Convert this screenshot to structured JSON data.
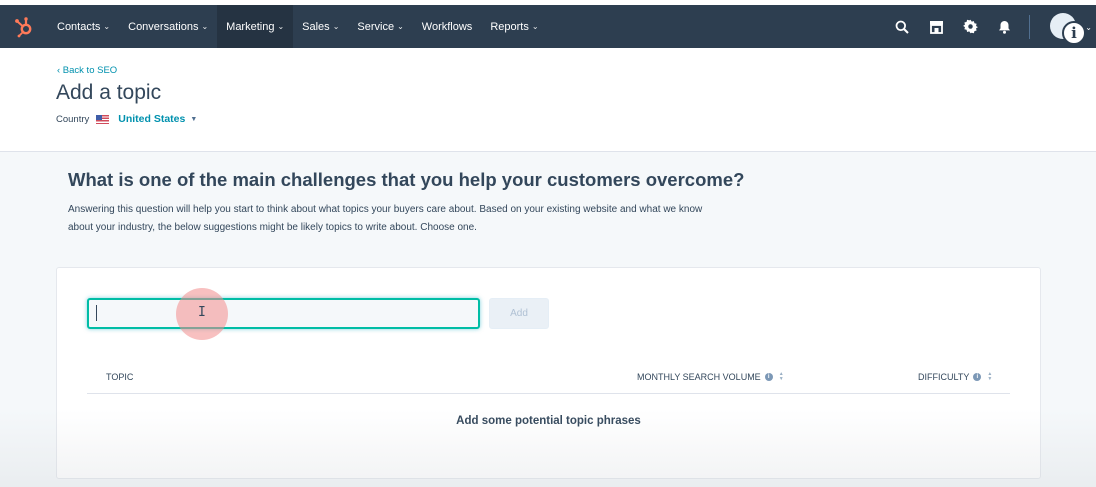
{
  "nav": {
    "items": [
      {
        "label": "Contacts",
        "has_caret": true,
        "active": false
      },
      {
        "label": "Conversations",
        "has_caret": true,
        "active": false
      },
      {
        "label": "Marketing",
        "has_caret": true,
        "active": true
      },
      {
        "label": "Sales",
        "has_caret": true,
        "active": false
      },
      {
        "label": "Service",
        "has_caret": true,
        "active": false
      },
      {
        "label": "Workflows",
        "has_caret": false,
        "active": false
      },
      {
        "label": "Reports",
        "has_caret": true,
        "active": false
      }
    ],
    "caret": "⌄",
    "right_icons": [
      "search-icon",
      "marketplace-icon",
      "settings-icon",
      "notifications-icon"
    ],
    "brand_color": "#ff7a59",
    "bar_color": "#2d3e50"
  },
  "header": {
    "back_link": "‹  Back to SEO",
    "title": "Add a topic",
    "country_label": "Country",
    "country_value": "United States",
    "country_caret": "▼"
  },
  "main": {
    "question": "What is one of the main challenges that you help your customers overcome?",
    "helper_line1": "Answering this question will help you start to think about what topics your buyers care about. Based on your existing website and what we know",
    "helper_line2": "about your industry, the below suggestions might be likely topics to write about. Choose one."
  },
  "form": {
    "input_value": "",
    "add_label": "Add",
    "ibeam": "I"
  },
  "table": {
    "columns": [
      "TOPIC",
      "MONTHLY SEARCH VOLUME",
      "DIFFICULTY"
    ],
    "info_glyph": "i",
    "empty_message": "Add some potential topic phrases"
  },
  "overlay": {
    "info_glyph": "i"
  }
}
